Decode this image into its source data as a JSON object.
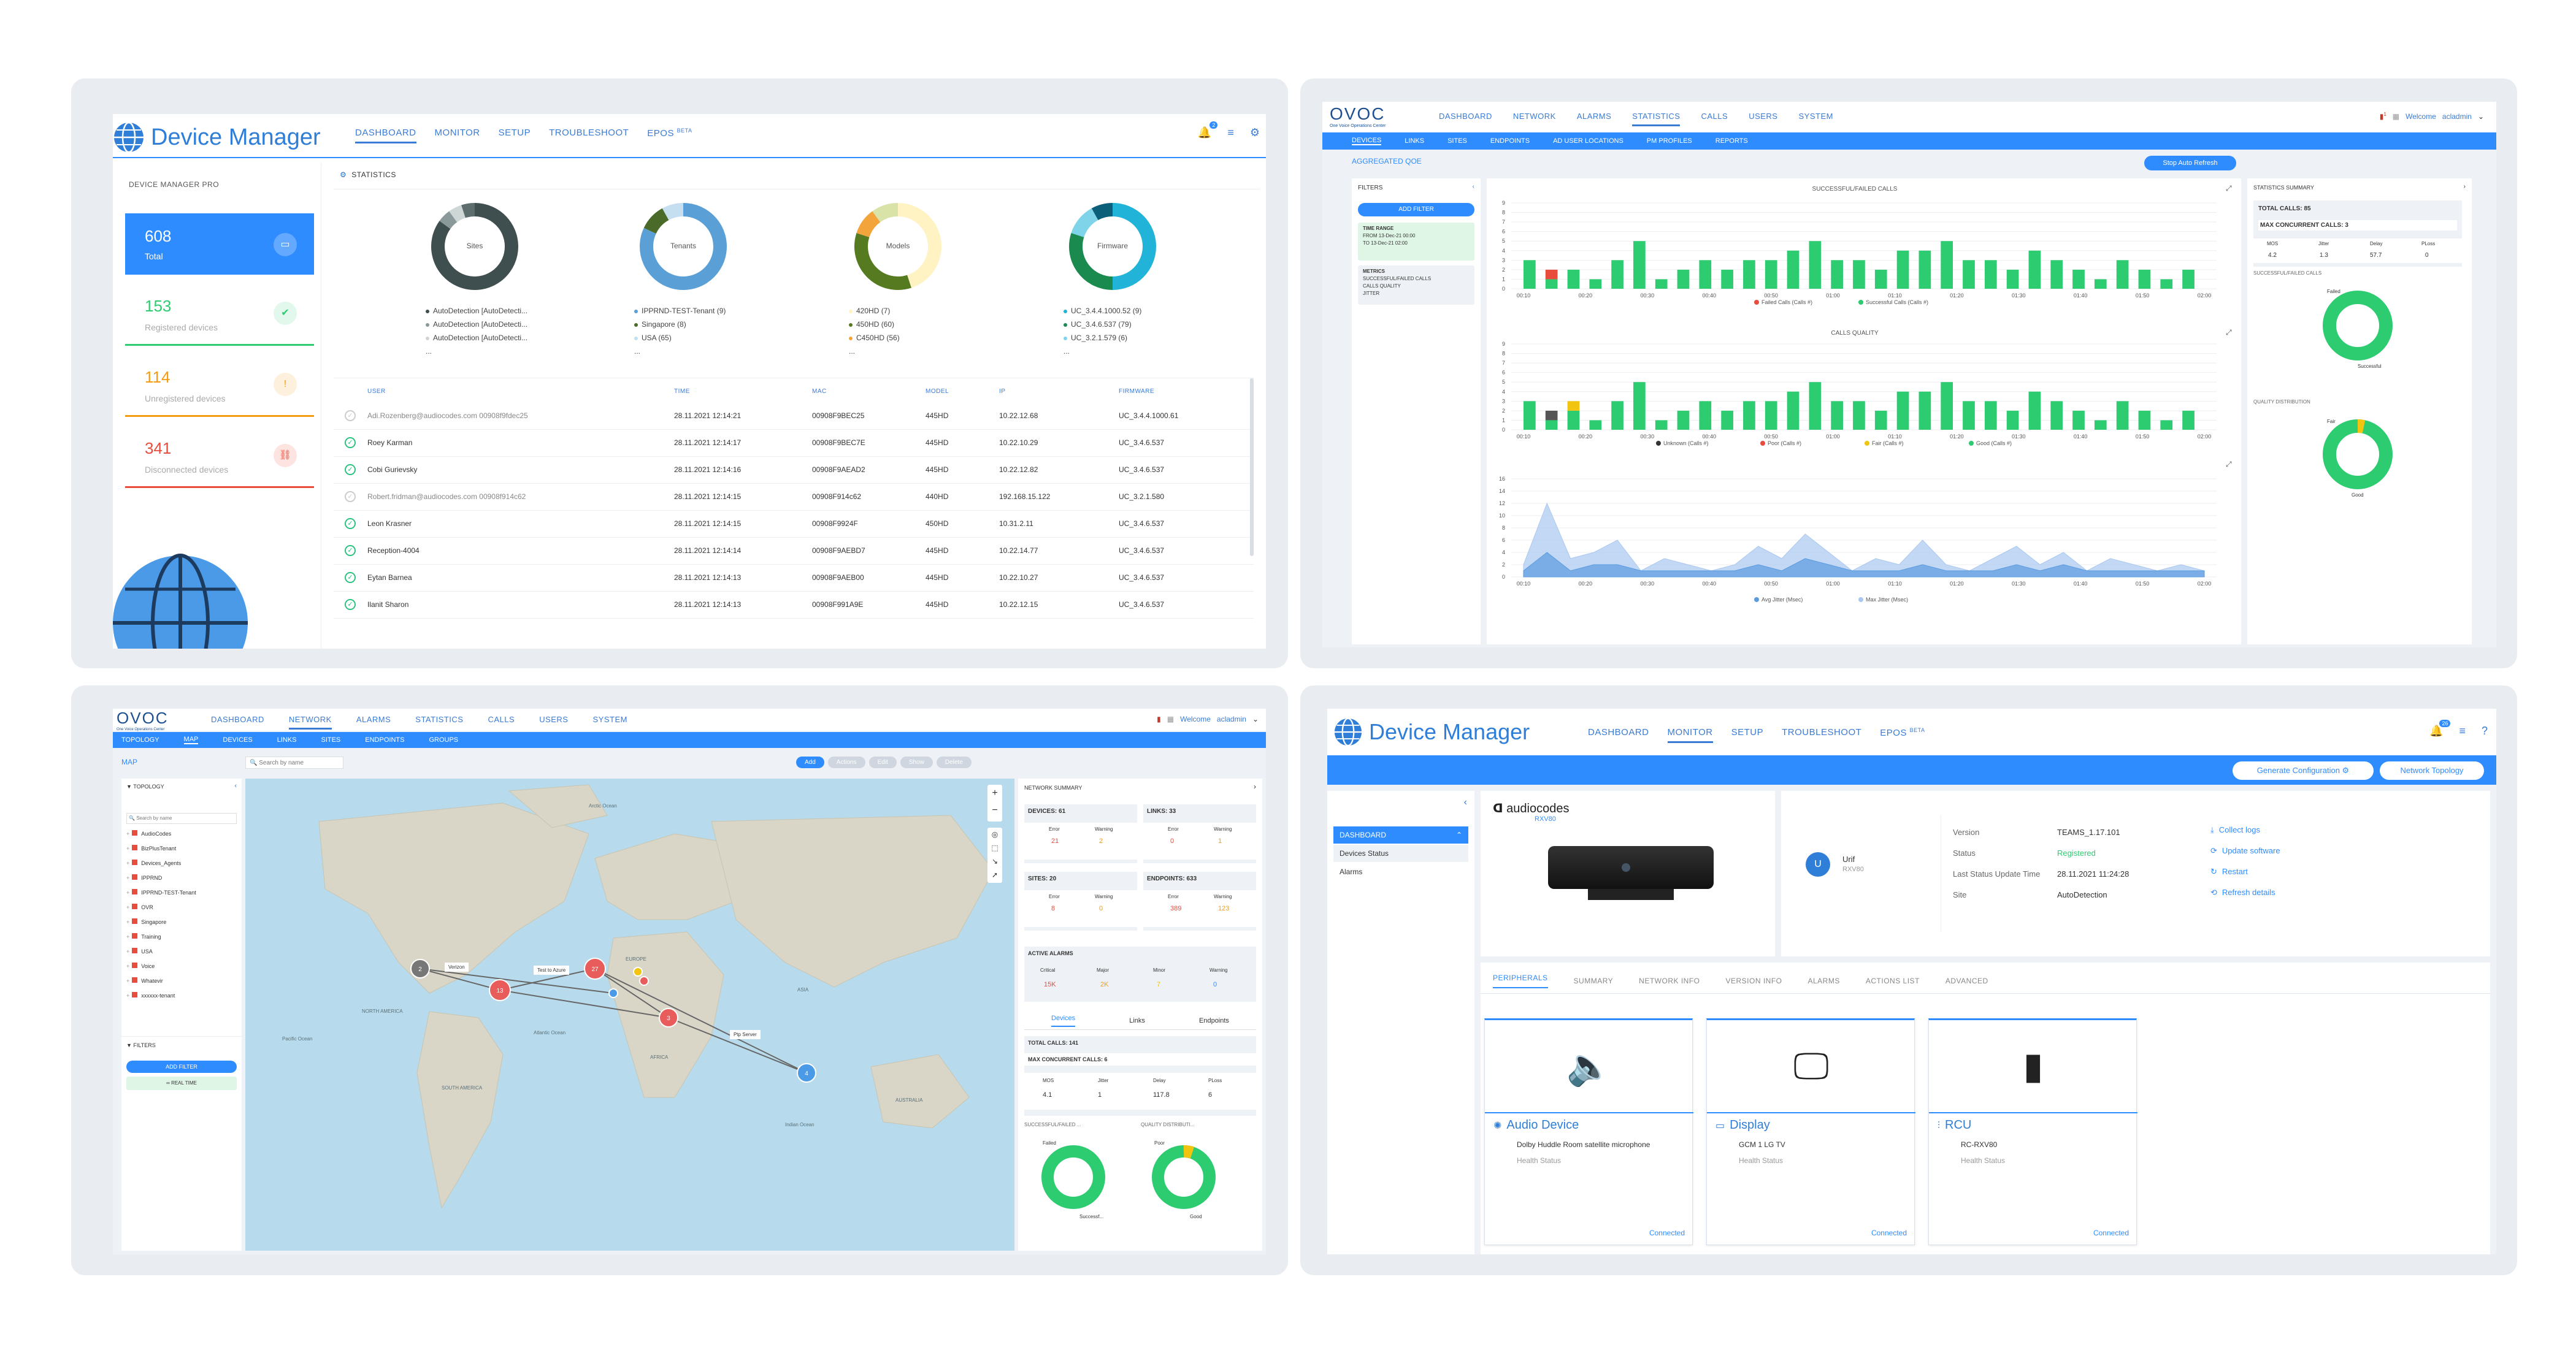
{
  "dm1": {
    "title": "Device Manager",
    "nav": [
      "DASHBOARD",
      "MONITOR",
      "SETUP",
      "TROUBLESHOOT",
      "EPOS"
    ],
    "nav_sup": "BETA",
    "notif_count": "2",
    "sidebar_title": "DEVICE MANAGER PRO",
    "tiles": [
      {
        "value": "608",
        "label": "Total"
      },
      {
        "value": "153",
        "label": "Registered devices"
      },
      {
        "value": "114",
        "label": "Unregistered devices"
      },
      {
        "value": "341",
        "label": "Disconnected devices"
      }
    ],
    "stats_title": "STATISTICS",
    "donuts": [
      {
        "label": "Sites",
        "legend": [
          "AutoDetection [AutoDetecti...",
          "AutoDetection [AutoDetecti...",
          "AutoDetection [AutoDetecti...",
          "..."
        ]
      },
      {
        "label": "Tenants",
        "legend": [
          "IPPRND-TEST-Tenant (9)",
          "Singapore (8)",
          "USA (65)",
          "..."
        ]
      },
      {
        "label": "Models",
        "legend": [
          "420HD (7)",
          "450HD (60)",
          "C450HD (56)",
          "..."
        ]
      },
      {
        "label": "Firmware",
        "legend": [
          "UC_3.4.4.1000.52 (9)",
          "UC_3.4.6.537 (79)",
          "UC_3.2.1.579 (6)",
          "..."
        ]
      }
    ],
    "columns": [
      "USER",
      "TIME",
      "MAC",
      "MODEL",
      "IP",
      "FIRMWARE"
    ],
    "rows": [
      {
        "status": "off",
        "user": "Adi.Rozenberg@audiocodes.com 00908f9fdec25",
        "time": "28.11.2021 12:14:21",
        "mac": "00908F9BEC25",
        "model": "445HD",
        "ip": "10.22.12.68",
        "fw": "UC_3.4.4.1000.61"
      },
      {
        "status": "on",
        "user": "Roey Karman",
        "time": "28.11.2021 12:14:17",
        "mac": "00908F9BEC7E",
        "model": "445HD",
        "ip": "10.22.10.29",
        "fw": "UC_3.4.6.537"
      },
      {
        "status": "on",
        "user": "Cobi Gurievsky",
        "time": "28.11.2021 12:14:16",
        "mac": "00908F9AEAD2",
        "model": "445HD",
        "ip": "10.22.12.82",
        "fw": "UC_3.4.6.537"
      },
      {
        "status": "off",
        "user": "Robert.fridman@audiocodes.com 00908f914c62",
        "time": "28.11.2021 12:14:15",
        "mac": "00908F914c62",
        "model": "440HD",
        "ip": "192.168.15.122",
        "fw": "UC_3.2.1.580"
      },
      {
        "status": "on",
        "user": "Leon Krasner",
        "time": "28.11.2021 12:14:15",
        "mac": "00908F9924F",
        "model": "450HD",
        "ip": "10.31.2.11",
        "fw": "UC_3.4.6.537"
      },
      {
        "status": "on",
        "user": "Reception-4004",
        "time": "28.11.2021 12:14:14",
        "mac": "00908F9AEBD7",
        "model": "445HD",
        "ip": "10.22.14.77",
        "fw": "UC_3.4.6.537"
      },
      {
        "status": "on",
        "user": "Eytan Barnea",
        "time": "28.11.2021 12:14:13",
        "mac": "00908F9AEB00",
        "model": "445HD",
        "ip": "10.22.10.27",
        "fw": "UC_3.4.6.537"
      },
      {
        "status": "on",
        "user": "Ilanit Sharon",
        "time": "28.11.2021 12:14:13",
        "mac": "00908F991A9E",
        "model": "445HD",
        "ip": "10.22.12.15",
        "fw": "UC_3.4.6.537"
      }
    ]
  },
  "ovoc1": {
    "logo": "OVOC",
    "logo_sub": "One Voice Operations Center",
    "nav": [
      "DASHBOARD",
      "NETWORK",
      "ALARMS",
      "STATISTICS",
      "CALLS",
      "USERS",
      "SYSTEM"
    ],
    "welcome": "Welcome",
    "user": "acladmin",
    "sub": [
      "DEVICES",
      "LINKS",
      "SITES",
      "ENDPOINTS",
      "AD USER LOCATIONS",
      "PM PROFILES",
      "REPORTS"
    ],
    "page_title": "AGGREGATED QOE",
    "stop_btn": "Stop Auto Refresh",
    "filters": "FILTERS",
    "add_filter": "ADD FILTER",
    "time_range": "TIME RANGE",
    "from": "FROM",
    "from_val": "13-Dec-21 00:00",
    "to": "TO",
    "to_val": "13-Dec-21 02:00",
    "metrics": "METRICS",
    "metric_vals": [
      "SUCCESSFUL/FAILED CALLS",
      "CALLS QUALITY",
      "JITTER"
    ],
    "chart1_title": "SUCCESSFUL/FAILED CALLS",
    "chart1_legend": [
      "Failed Calls (Calls #)",
      "Successful Calls (Calls #)"
    ],
    "chart2_title": "CALLS QUALITY",
    "chart2_legend": [
      "Unknown (Calls #)",
      "Poor (Calls #)",
      "Fair (Calls #)",
      "Good (Calls #)"
    ],
    "chart3_legend": [
      "Avg Jitter (Msec)",
      "Max Jitter (Msec)"
    ],
    "xticks": [
      "00:10",
      "00:20",
      "00:30",
      "00:40",
      "00:50",
      "01:00",
      "01:10",
      "01:20",
      "01:30",
      "01:40",
      "01:50",
      "02:00"
    ],
    "summary_title": "STATISTICS SUMMARY",
    "total_calls": "TOTAL CALLS: 85",
    "max_calls": "MAX CONCURRENT CALLS: 3",
    "kpi_labels": [
      "MOS",
      "Jitter",
      "Delay",
      "PLoss"
    ],
    "kpi_values": [
      "4.2",
      "1.3",
      "57.7",
      "0"
    ],
    "sf_title": "SUCCESSFUL/FAILED CALLS",
    "sf_labels": [
      "Failed",
      "Successful"
    ],
    "qd_title": "QUALITY DISTRIBUTION",
    "qd_labels": [
      "Fair",
      "Good"
    ],
    "notif": "1"
  },
  "ovoc2": {
    "logo": "OVOC",
    "logo_sub": "One Voice Operations Center",
    "nav": [
      "DASHBOARD",
      "NETWORK",
      "ALARMS",
      "STATISTICS",
      "CALLS",
      "USERS",
      "SYSTEM"
    ],
    "welcome": "Welcome",
    "user": "acladmin",
    "sub": [
      "TOPOLOGY",
      "MAP",
      "DEVICES",
      "LINKS",
      "SITES",
      "ENDPOINTS",
      "GROUPS"
    ],
    "page_title": "MAP",
    "search_ph": "Search by name",
    "actions": [
      "Add",
      "Actions",
      "Edit",
      "Show",
      "Delete"
    ],
    "topology": "TOPOLOGY",
    "tree": [
      "AudioCodes",
      "BizPlusTenant",
      "Devices_Agents",
      "IPPRND",
      "IPPRND-TEST-Tenant",
      "OVR",
      "Singapore",
      "Training",
      "USA",
      "Voice",
      "Whatevir",
      "xxxxxx-tenant"
    ],
    "filters": "FILTERS",
    "add_filter": "ADD FILTER",
    "real_time": "REAL TIME",
    "summary_title": "NETWORK SUMMARY",
    "boxes": [
      {
        "title": "DEVICES: 61",
        "l1": "Error",
        "l2": "Warning",
        "v1": "21",
        "v2": "2"
      },
      {
        "title": "LINKS: 33",
        "l1": "Error",
        "l2": "Warning",
        "v1": "0",
        "v2": "1"
      },
      {
        "title": "SITES: 20",
        "l1": "Error",
        "l2": "Warning",
        "v1": "8",
        "v2": "0"
      },
      {
        "title": "ENDPOINTS: 633",
        "l1": "Error",
        "l2": "Warning",
        "v1": "389",
        "v2": "123"
      }
    ],
    "alarms_title": "ACTIVE ALARMS",
    "alarm_labels": [
      "Critical",
      "Major",
      "Minor",
      "Warning"
    ],
    "alarm_values": [
      "15K",
      "2K",
      "7",
      "0"
    ],
    "tabs": [
      "Devices",
      "Links",
      "Endpoints"
    ],
    "total_calls": "TOTAL CALLS: 141",
    "max_calls": "MAX CONCURRENT CALLS: 6",
    "kpi_labels": [
      "MOS",
      "Jitter",
      "Delay",
      "PLoss"
    ],
    "kpi_values": [
      "4.1",
      "1",
      "117.8",
      "6"
    ],
    "sf_title": "SUCCESSFUL/FAILED ...",
    "qd_title": "QUALITY DISTRIBUTI...",
    "sf_labels": [
      "Failed",
      "Successf..."
    ],
    "qd_labels": [
      "Poor",
      "Good"
    ],
    "map_labels": [
      "NORTH AMERICA",
      "SOUTH AMERICA",
      "EUROPE",
      "AFRICA",
      "ASIA",
      "AUSTRALIA",
      "Atlantic Ocean",
      "Pacific Ocean",
      "Indian Ocean",
      "Arctic Ocean"
    ],
    "node_labels": [
      "Verizon",
      "Test to Azure",
      "Ptp Server"
    ],
    "nodes": [
      {
        "n": "2",
        "c": "#777"
      },
      {
        "n": "13",
        "c": "#e85c5c"
      },
      {
        "n": "27",
        "c": "#e85c5c"
      },
      {
        "n": "3",
        "c": "#e85c5c"
      },
      {
        "n": "4",
        "c": "#4a9ae8"
      }
    ]
  },
  "dm2": {
    "title": "Device Manager",
    "nav": [
      "DASHBOARD",
      "MONITOR",
      "SETUP",
      "TROUBLESHOOT",
      "EPOS"
    ],
    "nav_sup": "BETA",
    "notif_count": "26",
    "gen_btn": "Generate Configuration",
    "topo_btn": "Network Topology",
    "menu": [
      "DASHBOARD",
      "Devices Status",
      "Alarms"
    ],
    "brand": "audiocodes",
    "model": "RXV80",
    "avatar": "U",
    "user_name": "Urif",
    "user_model": "RXV80",
    "info_labels": [
      "Version",
      "Status",
      "Last Status Update Time",
      "Site"
    ],
    "info_values": [
      "TEAMS_1.17.101",
      "Registered",
      "28.11.2021 11:24:28",
      "AutoDetection"
    ],
    "actions": [
      "Collect logs",
      "Update software",
      "Restart",
      "Refresh details"
    ],
    "tabs": [
      "PERIPHERALS",
      "SUMMARY",
      "NETWORK INFO",
      "VERSION INFO",
      "ALARMS",
      "ACTIONS LIST",
      "ADVANCED"
    ],
    "periph": [
      {
        "name": "Audio Device",
        "model": "Dolby Huddle Room satellite microphone",
        "health": "Health Status",
        "state": "Connected"
      },
      {
        "name": "Display",
        "model": "GCM 1 LG TV",
        "health": "Health Status",
        "state": "Connected"
      },
      {
        "name": "RCU",
        "model": "RC-RXV80",
        "health": "Health Status",
        "state": "Connected"
      }
    ]
  },
  "colors": {
    "accent": "#2f8cff",
    "green": "#2ecc71",
    "red": "#e74c3c",
    "orange": "#f39c12"
  },
  "chart_data": [
    {
      "type": "bar",
      "title": "SUCCESSFUL/FAILED CALLS",
      "x": [
        "00:10",
        "00:20",
        "00:30",
        "00:40",
        "00:50",
        "01:00",
        "01:10",
        "01:20",
        "01:30",
        "01:40",
        "01:50",
        "02:00"
      ],
      "series": [
        {
          "name": "Successful Calls (Calls #)",
          "values": [
            3,
            1,
            2,
            1,
            3,
            5,
            1,
            2,
            3,
            2,
            3,
            3,
            4,
            5,
            3,
            3,
            2,
            4,
            4,
            5,
            3,
            3,
            2,
            4,
            3,
            2,
            1,
            3,
            2,
            1,
            2
          ]
        },
        {
          "name": "Failed Calls (Calls #)",
          "values": [
            0,
            1,
            0,
            0,
            0,
            0,
            0,
            0,
            0,
            0,
            0,
            0,
            0,
            0,
            0,
            0,
            0,
            0,
            0,
            0,
            0,
            0,
            0,
            0,
            0,
            0,
            0,
            0,
            0,
            0,
            0
          ]
        }
      ],
      "ylim": [
        0,
        9
      ]
    },
    {
      "type": "bar",
      "title": "CALLS QUALITY",
      "x": [
        "00:10",
        "00:20",
        "00:30",
        "00:40",
        "00:50",
        "01:00",
        "01:10",
        "01:20",
        "01:30",
        "01:40",
        "01:50",
        "02:00"
      ],
      "series": [
        {
          "name": "Good (Calls #)",
          "values": [
            3,
            1,
            2,
            1,
            3,
            5,
            1,
            2,
            3,
            2,
            3,
            3,
            4,
            5,
            3,
            3,
            2,
            4,
            4,
            5,
            3,
            3,
            2,
            4,
            3,
            2,
            1,
            3,
            2,
            1,
            2
          ]
        },
        {
          "name": "Fair (Calls #)",
          "values": [
            0,
            0,
            1,
            0,
            0,
            0,
            0,
            0,
            0,
            0,
            0,
            0,
            0,
            0,
            0,
            0,
            0,
            0,
            0,
            0,
            0,
            0,
            0,
            0,
            0,
            0,
            0,
            0,
            0,
            0,
            0
          ]
        },
        {
          "name": "Unknown (Calls #)",
          "values": [
            0,
            1,
            0,
            0,
            0,
            0,
            0,
            0,
            0,
            0,
            0,
            0,
            0,
            0,
            0,
            0,
            0,
            0,
            0,
            0,
            0,
            0,
            0,
            0,
            0,
            0,
            0,
            0,
            0,
            0,
            0
          ]
        }
      ],
      "ylim": [
        0,
        9
      ]
    },
    {
      "type": "area",
      "x": [
        "00:10",
        "00:20",
        "00:30",
        "00:40",
        "00:50",
        "01:00",
        "01:10",
        "01:20",
        "01:30",
        "01:40",
        "01:50",
        "02:00"
      ],
      "series": [
        {
          "name": "Max Jitter (Msec)",
          "values": [
            2,
            12,
            3,
            4,
            6,
            1,
            3,
            2,
            1,
            2,
            5,
            3,
            7,
            4,
            1,
            3,
            2,
            6,
            2,
            1,
            3,
            5,
            2,
            4,
            1,
            3,
            2,
            1,
            2,
            1
          ]
        },
        {
          "name": "Avg Jitter (Msec)",
          "values": [
            1,
            4,
            1,
            2,
            2,
            1,
            1,
            1,
            1,
            1,
            2,
            1,
            3,
            2,
            1,
            1,
            1,
            2,
            1,
            1,
            1,
            2,
            1,
            2,
            1,
            1,
            1,
            1,
            1,
            1
          ]
        }
      ],
      "ylim": [
        0,
        16
      ]
    }
  ]
}
